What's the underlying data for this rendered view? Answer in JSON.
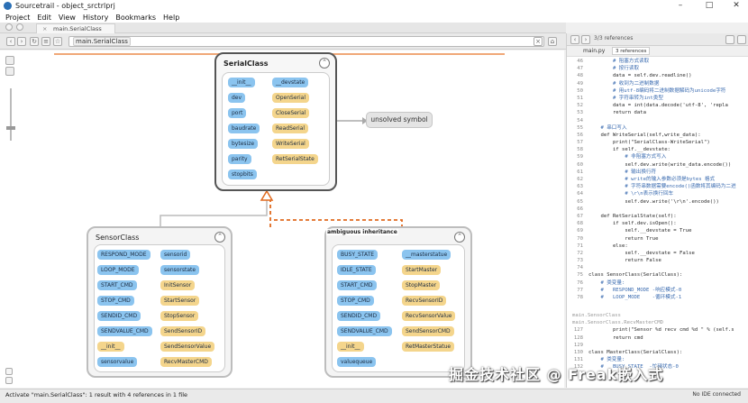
{
  "window": {
    "title": "Sourcetrail - object_srctrlprj",
    "min": "–",
    "max": "□",
    "close": "✕"
  },
  "menu": [
    "Project",
    "Edit",
    "View",
    "History",
    "Bookmarks",
    "Help"
  ],
  "tab": {
    "label": "main.SerialClass",
    "close": "×"
  },
  "search": {
    "query": "main.SerialClass"
  },
  "graph": {
    "main_class": {
      "title": "SerialClass",
      "blue": [
        "__init__",
        "dev",
        "port",
        "baudrate",
        "bytesize",
        "parity",
        "stopbits",
        "__devstate"
      ],
      "yellow": [
        "OpenSerial",
        "CloseSerial",
        "ReadSerial",
        "WriteSerial",
        "RetSerialState"
      ]
    },
    "unsolved": "unsolved symbol",
    "sensor_class": {
      "title": "SensorClass",
      "left": [
        "RESPOND_MODE",
        "LOOP_MODE",
        "START_CMD",
        "STOP_CMD",
        "SENDID_CMD",
        "SENDVALUE_CMD",
        "__init__",
        "sensorvalue"
      ],
      "right": [
        "sensorid",
        "sensorstate",
        "InitSensor",
        "StartSensor",
        "StopSensor",
        "SendSensorID",
        "SendSensorValue",
        "RecvMasterCMD"
      ]
    },
    "ambiguous_label": "ambiguous inheritance",
    "master_class": {
      "left": [
        "BUSY_STATE",
        "IDLE_STATE",
        "START_CMD",
        "STOP_CMD",
        "SENDID_CMD",
        "SENDVALUE_CMD",
        "__init__",
        "valuequeue"
      ],
      "right": [
        "__masterstatue",
        "StartMaster",
        "StopMaster",
        "RecvSensorID",
        "RecvSensorValue",
        "SendSensorCMD",
        "RetMasterStatue"
      ]
    }
  },
  "code_panel": {
    "ref_count": "3/3 references",
    "file": "main.py",
    "refs": "3 references",
    "lines": [
      {
        "n": "46",
        "t": "        # 阻塞方式读取",
        "c": true
      },
      {
        "n": "47",
        "t": "        # 按行读取",
        "c": true
      },
      {
        "n": "48",
        "t": "        data = self.dev.readline()",
        "c": false
      },
      {
        "n": "49",
        "t": "        # 收到为二进制数据",
        "c": true
      },
      {
        "n": "50",
        "t": "        # 用utf-8编码将二进制数据解码为unicode字符",
        "c": true
      },
      {
        "n": "51",
        "t": "        # 字符串转为int类型",
        "c": true
      },
      {
        "n": "52",
        "t": "        data = int(data.decode('utf-8', 'repla",
        "c": false
      },
      {
        "n": "53",
        "t": "        return data",
        "c": false
      },
      {
        "n": "54",
        "t": "",
        "c": false
      },
      {
        "n": "55",
        "t": "    # 串口写入",
        "c": true
      },
      {
        "n": "56",
        "t": "    def WriteSerial(self,write_data):",
        "c": false
      },
      {
        "n": "57",
        "t": "        print(\"SerialClass-WriteSerial\")",
        "c": false
      },
      {
        "n": "58",
        "t": "        if self.__devstate:",
        "c": false
      },
      {
        "n": "59",
        "t": "            # 非阻塞方式写入",
        "c": true
      },
      {
        "n": "60",
        "t": "            self.dev.write(write_data.encode())",
        "c": false
      },
      {
        "n": "61",
        "t": "            # 输出换行符",
        "c": true
      },
      {
        "n": "62",
        "t": "            # write的输入参数必须是bytes 格式",
        "c": true
      },
      {
        "n": "63",
        "t": "            # 字符串数据需要encode()函数将其编码为二进",
        "c": true
      },
      {
        "n": "64",
        "t": "            # \\r\\n表示换行回车",
        "c": true
      },
      {
        "n": "65",
        "t": "            self.dev.write('\\r\\n'.encode())",
        "c": false
      },
      {
        "n": "66",
        "t": "",
        "c": false
      },
      {
        "n": "67",
        "t": "    def RetSerialState(self):",
        "c": false
      },
      {
        "n": "68",
        "t": "        if self.dev.isOpen():",
        "c": false
      },
      {
        "n": "69",
        "t": "            self.__devstate = True",
        "c": false
      },
      {
        "n": "70",
        "t": "            return True",
        "c": false
      },
      {
        "n": "71",
        "t": "        else:",
        "c": false
      },
      {
        "n": "72",
        "t": "            self.__devstate = False",
        "c": false
      },
      {
        "n": "73",
        "t": "            return False",
        "c": false
      },
      {
        "n": "74",
        "t": "",
        "c": false
      },
      {
        "n": "75",
        "t": "class SensorClass(SerialClass):",
        "c": false
      },
      {
        "n": "76",
        "t": "    # 类变量:",
        "c": true
      },
      {
        "n": "77",
        "t": "    #   RESPOND_MODE -响应模式-0",
        "c": true
      },
      {
        "n": "78",
        "t": "    #   LOOP_MODE    -循环模式-1",
        "c": true
      }
    ],
    "sep1": "main.SensorClass",
    "sep2": "main.SensorClass.RecvMasterCMD",
    "lines2": [
      {
        "n": "127",
        "t": "        print(\"Sensor %d recv cmd %d \" % (self.s",
        "c": false
      },
      {
        "n": "128",
        "t": "        return cmd",
        "c": false
      },
      {
        "n": "129",
        "t": "",
        "c": false
      },
      {
        "n": "130",
        "t": "class MasterClass(SerialClass):",
        "c": false
      },
      {
        "n": "131",
        "t": "    # 类变量:",
        "c": true
      },
      {
        "n": "132",
        "t": "    #   BUSY_STATE  -忙碌状态-0",
        "c": true
      }
    ]
  },
  "status": {
    "text": "Activate \"main.SerialClass\": 1 result with 4 references in 1 file",
    "ide": "No IDE connected"
  },
  "watermark": "掘金技术社区 @ Freak嵌入式"
}
